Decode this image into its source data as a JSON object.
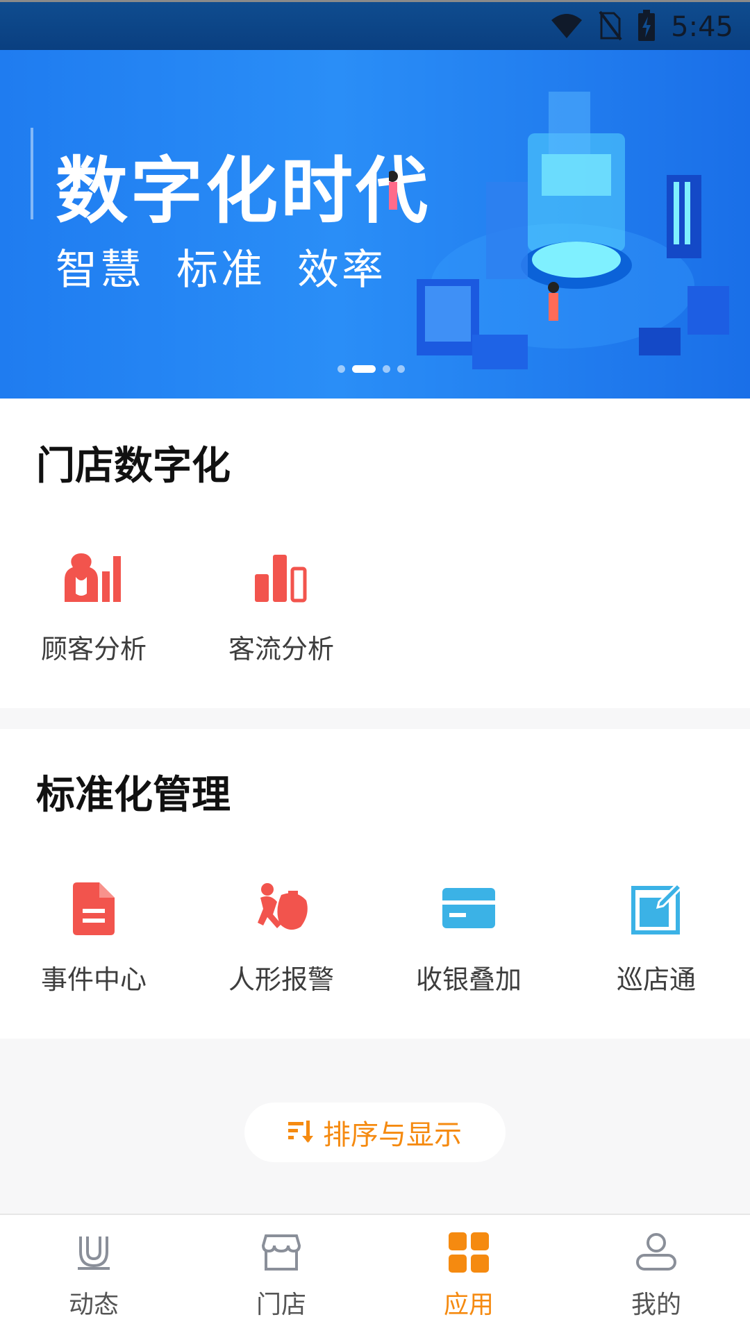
{
  "status_bar": {
    "time": "5:45",
    "icons": [
      "wifi-icon",
      "no-sim-icon",
      "battery-charging-icon"
    ]
  },
  "banner": {
    "title": "数字化时代",
    "subtitles": [
      "智慧",
      "标准",
      "效率"
    ],
    "page_count": 4,
    "active_page": 2
  },
  "section_digital": {
    "title": "门店数字化",
    "items": [
      {
        "label": "顾客分析",
        "icon": "customer-analysis-icon"
      },
      {
        "label": "客流分析",
        "icon": "traffic-analysis-icon"
      }
    ]
  },
  "section_standard": {
    "title": "标准化管理",
    "items": [
      {
        "label": "事件中心",
        "icon": "event-document-icon"
      },
      {
        "label": "人形报警",
        "icon": "thief-alarm-icon"
      },
      {
        "label": "收银叠加",
        "icon": "card-icon"
      },
      {
        "label": "巡店通",
        "icon": "edit-square-icon"
      }
    ]
  },
  "sort_button": {
    "label": "排序与显示",
    "icon": "sort-icon"
  },
  "tabbar": {
    "tabs": [
      {
        "label": "动态",
        "icon": "magnet-icon",
        "active": false
      },
      {
        "label": "门店",
        "icon": "store-icon",
        "active": false
      },
      {
        "label": "应用",
        "icon": "apps-grid-icon",
        "active": true
      },
      {
        "label": "我的",
        "icon": "user-icon",
        "active": false
      }
    ]
  },
  "colors": {
    "accent": "#f58a10",
    "icon_red": "#f2544d",
    "icon_blue": "#3bb2e6",
    "banner_blue": "#2a8ef7"
  }
}
